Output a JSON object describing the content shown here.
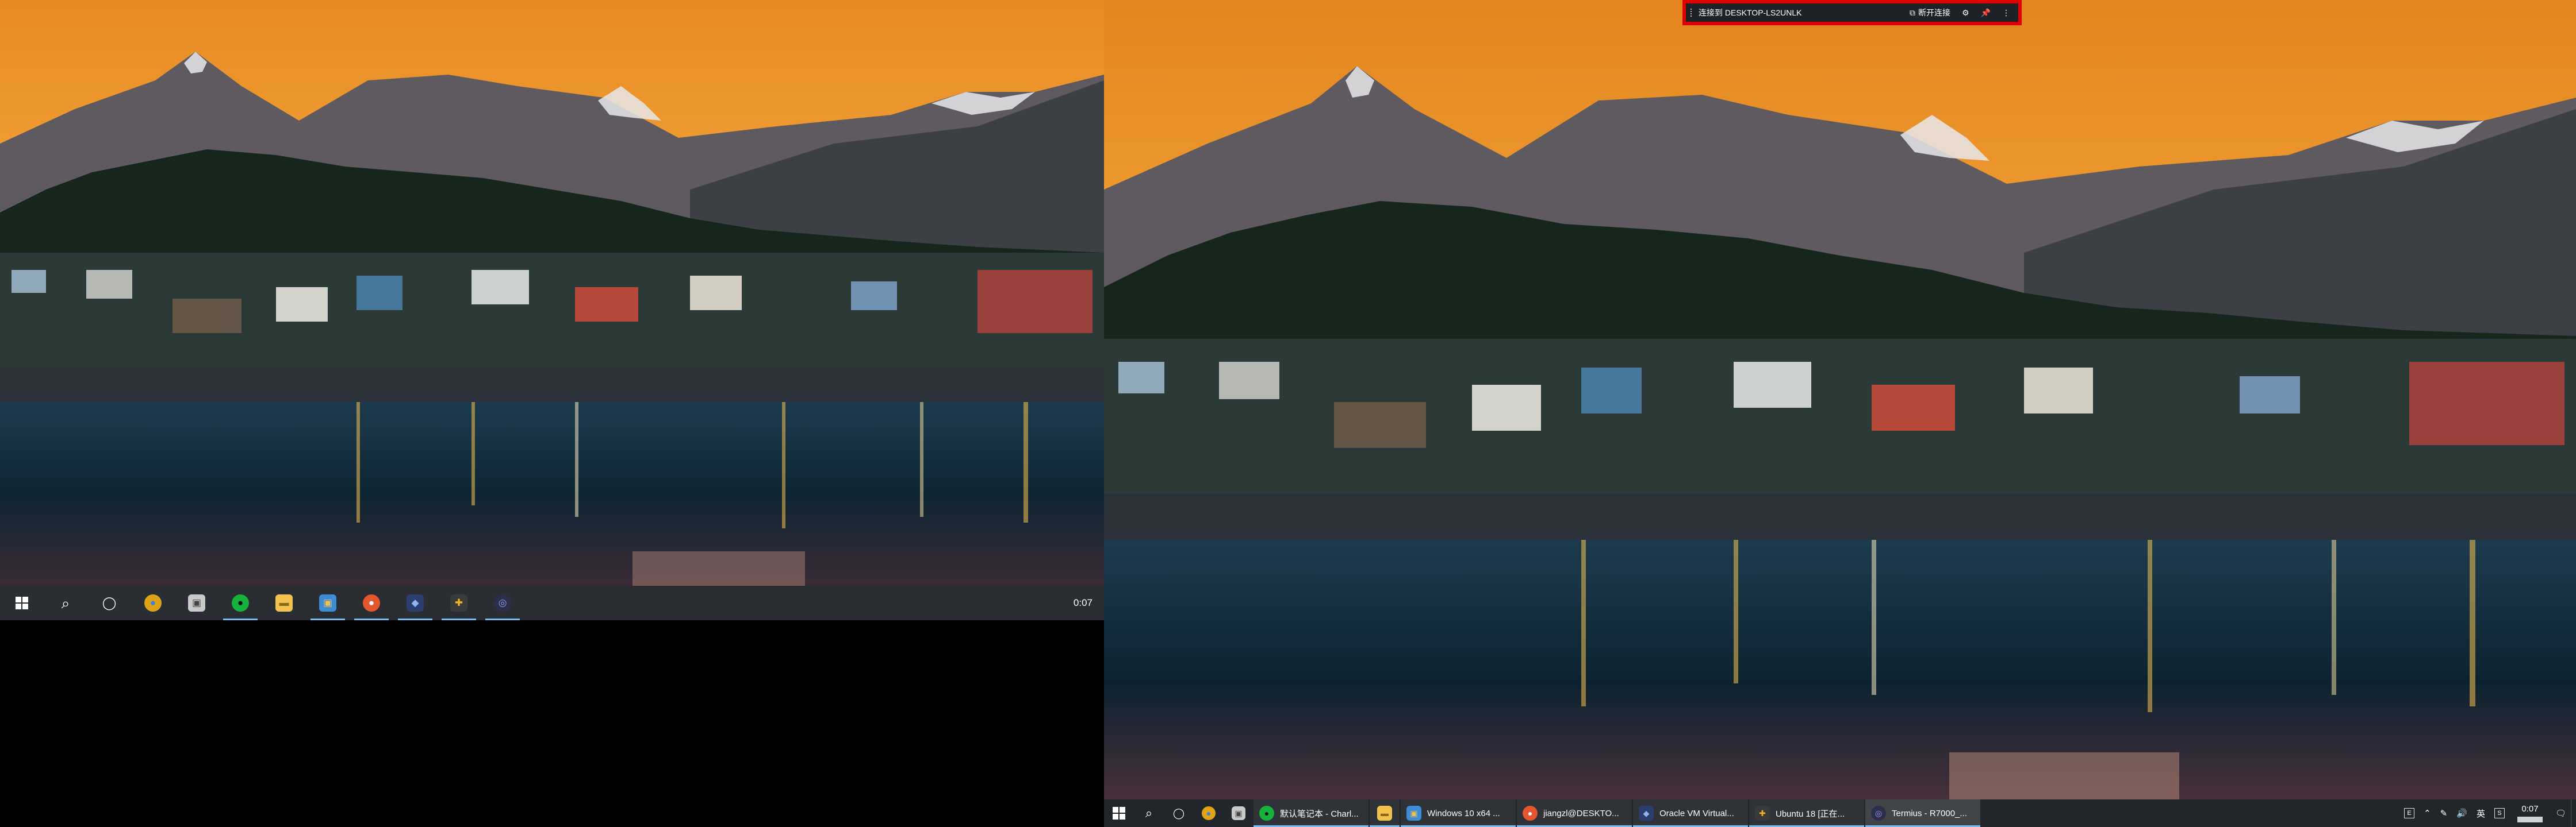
{
  "left_monitor": {
    "taskbar": {
      "pinned": [
        {
          "name": "search",
          "glyph": "⌕"
        },
        {
          "name": "cortana",
          "glyph": "◯"
        },
        {
          "name": "chrome",
          "glyph": "●",
          "color": "#e0a317"
        },
        {
          "name": "store",
          "glyph": "▣",
          "color": "#c9c9c9"
        },
        {
          "name": "wechat",
          "glyph": "●",
          "color": "#16b33c"
        },
        {
          "name": "file-explorer",
          "glyph": "▬",
          "color": "#f2c14e"
        },
        {
          "name": "windows-vm",
          "glyph": "▣",
          "color": "#3c8cd6"
        },
        {
          "name": "jump-client",
          "glyph": "●",
          "color": "#e4562e"
        },
        {
          "name": "virtualbox",
          "glyph": "◆",
          "color": "#4d73c2"
        },
        {
          "name": "ubuntu-vm",
          "glyph": "✚",
          "color": "#f0b429"
        },
        {
          "name": "termius",
          "glyph": "◎",
          "color": "#6c7ae0"
        }
      ],
      "clock": "0:07"
    }
  },
  "right_monitor": {
    "connection_bar": {
      "title": "连接到 DESKTOP-LS2UNLK",
      "disconnect_label": "断开连接"
    },
    "taskbar": {
      "pinned": [
        {
          "name": "search",
          "glyph": "⌕"
        },
        {
          "name": "cortana",
          "glyph": "◯"
        },
        {
          "name": "chrome",
          "glyph": "●",
          "color": "#e0a317"
        },
        {
          "name": "store",
          "glyph": "▣",
          "color": "#c9c9c9"
        }
      ],
      "tasks": [
        {
          "label": "默认笔记本 - Charl...",
          "color": "#16b33c",
          "glyph": "●"
        },
        {
          "label": "",
          "color": "#f2c14e",
          "glyph": "▬",
          "icon_only": true
        },
        {
          "label": "Windows 10 x64 ...",
          "color": "#3c8cd6",
          "glyph": "▣"
        },
        {
          "label": "jiangzl@DESKTO...",
          "color": "#e4562e",
          "glyph": "●"
        },
        {
          "label": "Oracle VM Virtual...",
          "color": "#4d73c2",
          "glyph": "◆"
        },
        {
          "label": "Ubuntu 18 [正在...",
          "color": "#f0b429",
          "glyph": "✚"
        },
        {
          "label": "Termius - R7000_...",
          "color": "#6c7ae0",
          "glyph": "◎",
          "active": true
        }
      ],
      "tray": {
        "ime": "英",
        "clock": "0:07"
      }
    }
  }
}
